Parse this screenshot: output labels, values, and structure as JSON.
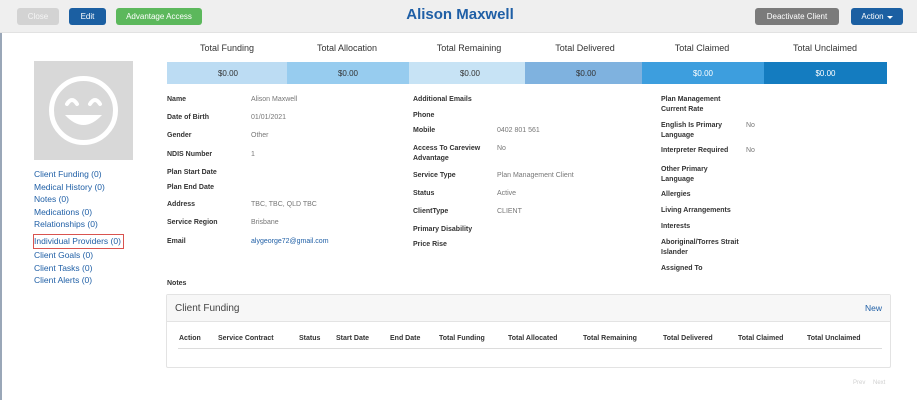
{
  "toolbar": {
    "close_label": "Close",
    "edit_label": "Edit",
    "advantage_label": "Advantage Access",
    "deactivate_label": "Deactivate Client",
    "action_label": "Action"
  },
  "client": {
    "name": "Alison Maxwell"
  },
  "financials": {
    "headers": [
      "Total Funding",
      "Total Allocation",
      "Total Remaining",
      "Total Delivered",
      "Total Claimed",
      "Total Unclaimed"
    ],
    "values": [
      "$0.00",
      "$0.00",
      "$0.00",
      "$0.00",
      "$0.00",
      "$0.00"
    ],
    "colors": [
      "#bcdcf3",
      "#97ccef",
      "#c7e3f5",
      "#7fb2df",
      "#3d9ede",
      "#147cc0"
    ]
  },
  "sidebar": {
    "links": [
      "Client Funding (0)",
      "Medical History (0)",
      "Notes (0)",
      "Medications (0)",
      "Relationships (0)",
      "Individual Providers (0)",
      "Client Goals (0)",
      "Client Tasks (0)",
      "Client Alerts (0)"
    ]
  },
  "details": {
    "col1": [
      {
        "label": "Name",
        "value": "Alison Maxwell"
      },
      {
        "label": "Date of Birth",
        "value": "01/01/2021"
      },
      {
        "label": "Gender",
        "value": "Other"
      },
      {
        "label": "NDIS Number",
        "value": "1"
      },
      {
        "label": "Plan Start Date",
        "value": ""
      },
      {
        "label": "Plan End Date",
        "value": ""
      },
      {
        "label": "Address",
        "value": "TBC, TBC, QLD TBC"
      },
      {
        "label": "Service Region",
        "value": "Brisbane"
      },
      {
        "label": "Email",
        "value": "alygeorge72@gmail.com"
      }
    ],
    "col2": [
      {
        "label": "Additional Emails",
        "value": ""
      },
      {
        "label": "Phone",
        "value": ""
      },
      {
        "label": "Mobile",
        "value": "0402 801 561"
      },
      {
        "label": "Access To Careview Advantage",
        "value": "No"
      },
      {
        "label": "Service Type",
        "value": "Plan Management Client"
      },
      {
        "label": "Status",
        "value": "Active"
      },
      {
        "label": "ClientType",
        "value": "CLIENT"
      },
      {
        "label": "Primary Disability",
        "value": ""
      },
      {
        "label": "Price Rise",
        "value": ""
      }
    ],
    "col3": [
      {
        "label": "Plan Management Current Rate",
        "value": ""
      },
      {
        "label": "English Is Primary Language",
        "value": "No"
      },
      {
        "label": "Interpreter Required",
        "value": "No"
      },
      {
        "label": "Other Primary Language",
        "value": ""
      },
      {
        "label": "Allergies",
        "value": ""
      },
      {
        "label": "Living Arrangements",
        "value": ""
      },
      {
        "label": "Interests",
        "value": ""
      },
      {
        "label": "Aboriginal/Torres Strait Islander",
        "value": ""
      },
      {
        "label": "Assigned To",
        "value": ""
      }
    ]
  },
  "notes_label": "Notes",
  "funding_panel": {
    "title": "Client Funding",
    "new_label": "New",
    "columns": [
      "Action",
      "Service Contract",
      "Status",
      "Start Date",
      "End Date",
      "Total Funding",
      "Total Allocated",
      "Total Remaining",
      "Total Delivered",
      "Total Claimed",
      "Total Unclaimed"
    ]
  },
  "pager": {
    "prev": "Prev",
    "next": "Next"
  }
}
